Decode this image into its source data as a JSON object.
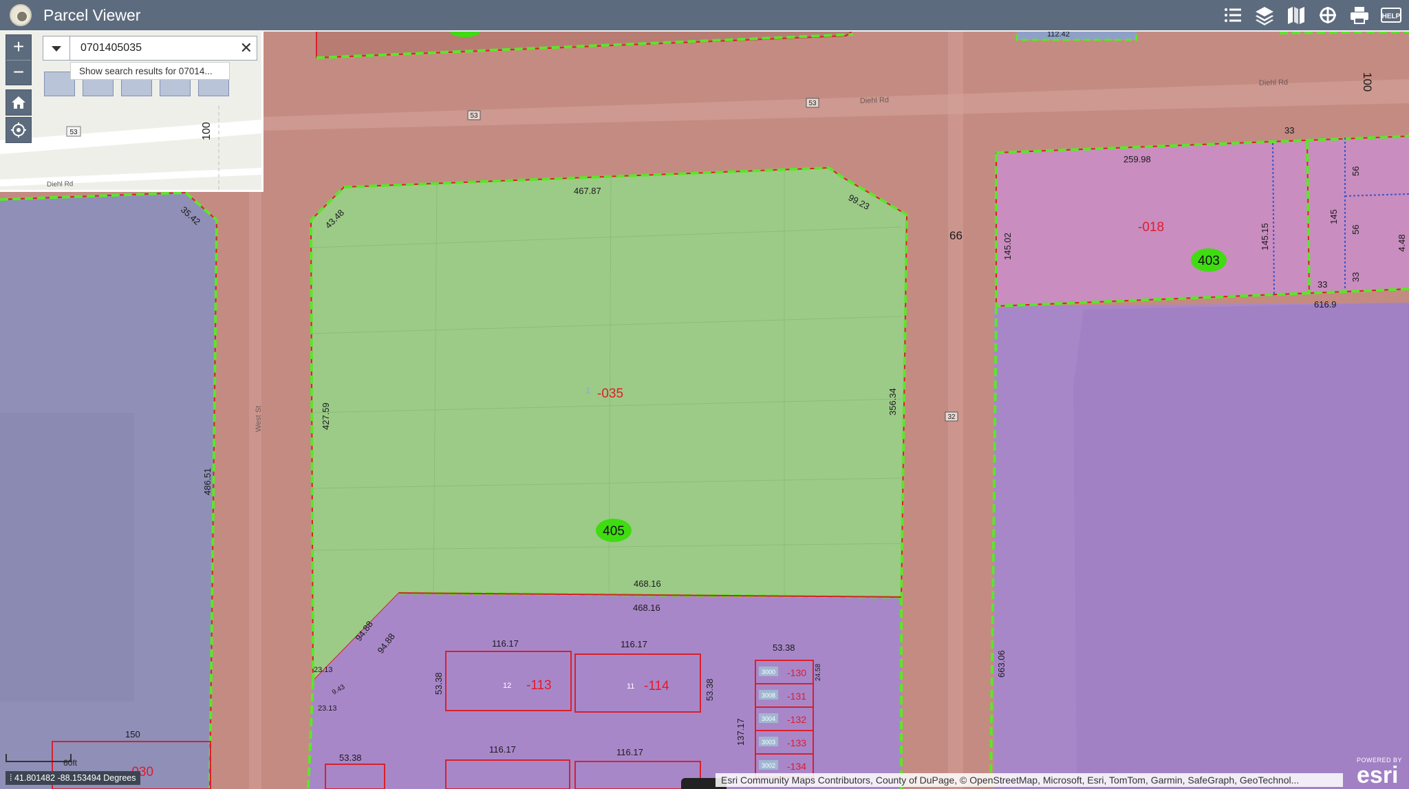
{
  "app": {
    "title": "Parcel Viewer"
  },
  "toolbar": {
    "icons": [
      "legend-icon",
      "layers-icon",
      "basemap-icon",
      "measure-icon",
      "print-icon",
      "help-icon"
    ],
    "help_label": "HELP"
  },
  "search": {
    "value": "0701405035",
    "suggestion": "Show search results for 07014..."
  },
  "inset": {
    "road_label": "Diehl Rd",
    "route_shield": "53",
    "measure_label": "100"
  },
  "map": {
    "road_labels": [
      "Diehl Rd",
      "Diehl Rd",
      "Diehl Rd",
      "West St"
    ],
    "route_shields": [
      "53",
      "53",
      "32"
    ],
    "parcels": {
      "p035": {
        "id": "-035",
        "marker": "1",
        "zone": "405"
      },
      "p018": {
        "id": "-018",
        "zone": "403"
      },
      "p113": {
        "id": "-113",
        "marker": "12"
      },
      "p114": {
        "id": "-114",
        "marker": "11"
      },
      "p030": {
        "id": "-030"
      },
      "units": [
        {
          "code": "3000",
          "id": "-130"
        },
        {
          "code": "3008",
          "id": "-131"
        },
        {
          "code": "3004",
          "id": "-132"
        },
        {
          "code": "3003",
          "id": "-133"
        },
        {
          "code": "3002",
          "id": "-134"
        }
      ]
    },
    "dimensions": [
      "467.87",
      "99.23",
      "43.48",
      "427.59",
      "356.34",
      "468.16",
      "468.16",
      "94.88",
      "94.88",
      "23.13",
      "23.13",
      "9.43",
      "116.17",
      "116.17",
      "53.38",
      "53.38",
      "53.38",
      "24.58",
      "137.17",
      "116.17",
      "116.17",
      "53.38",
      "150",
      "486.51",
      "35.42",
      "66",
      "100",
      "33",
      "259.98",
      "145.02",
      "145.15",
      "145",
      "56",
      "56",
      "33",
      "33",
      "616.9",
      "663.06",
      "4.48",
      "112.42"
    ]
  },
  "status": {
    "coordinates": "41.801482 -88.153494 Degrees",
    "scale": "60ft"
  },
  "attribution": "Esri Community Maps Contributors, County of DuPage, © OpenStreetMap, Microsoft, Esri, TomTom, Garmin, SafeGraph, GeoTechnol...",
  "esri": {
    "powered_by": "POWERED BY",
    "brand": "esri"
  },
  "colors": {
    "roads": "#c48b82",
    "zoning_green": "#9ccb88",
    "zoning_purple": "#a887c9",
    "zoning_pink": "#c98dc0",
    "zoning_blue": "#8f8fb8",
    "parcel_line": "#d8202a",
    "zone_outline": "#5ce62a",
    "header": "#5d6b7e"
  }
}
